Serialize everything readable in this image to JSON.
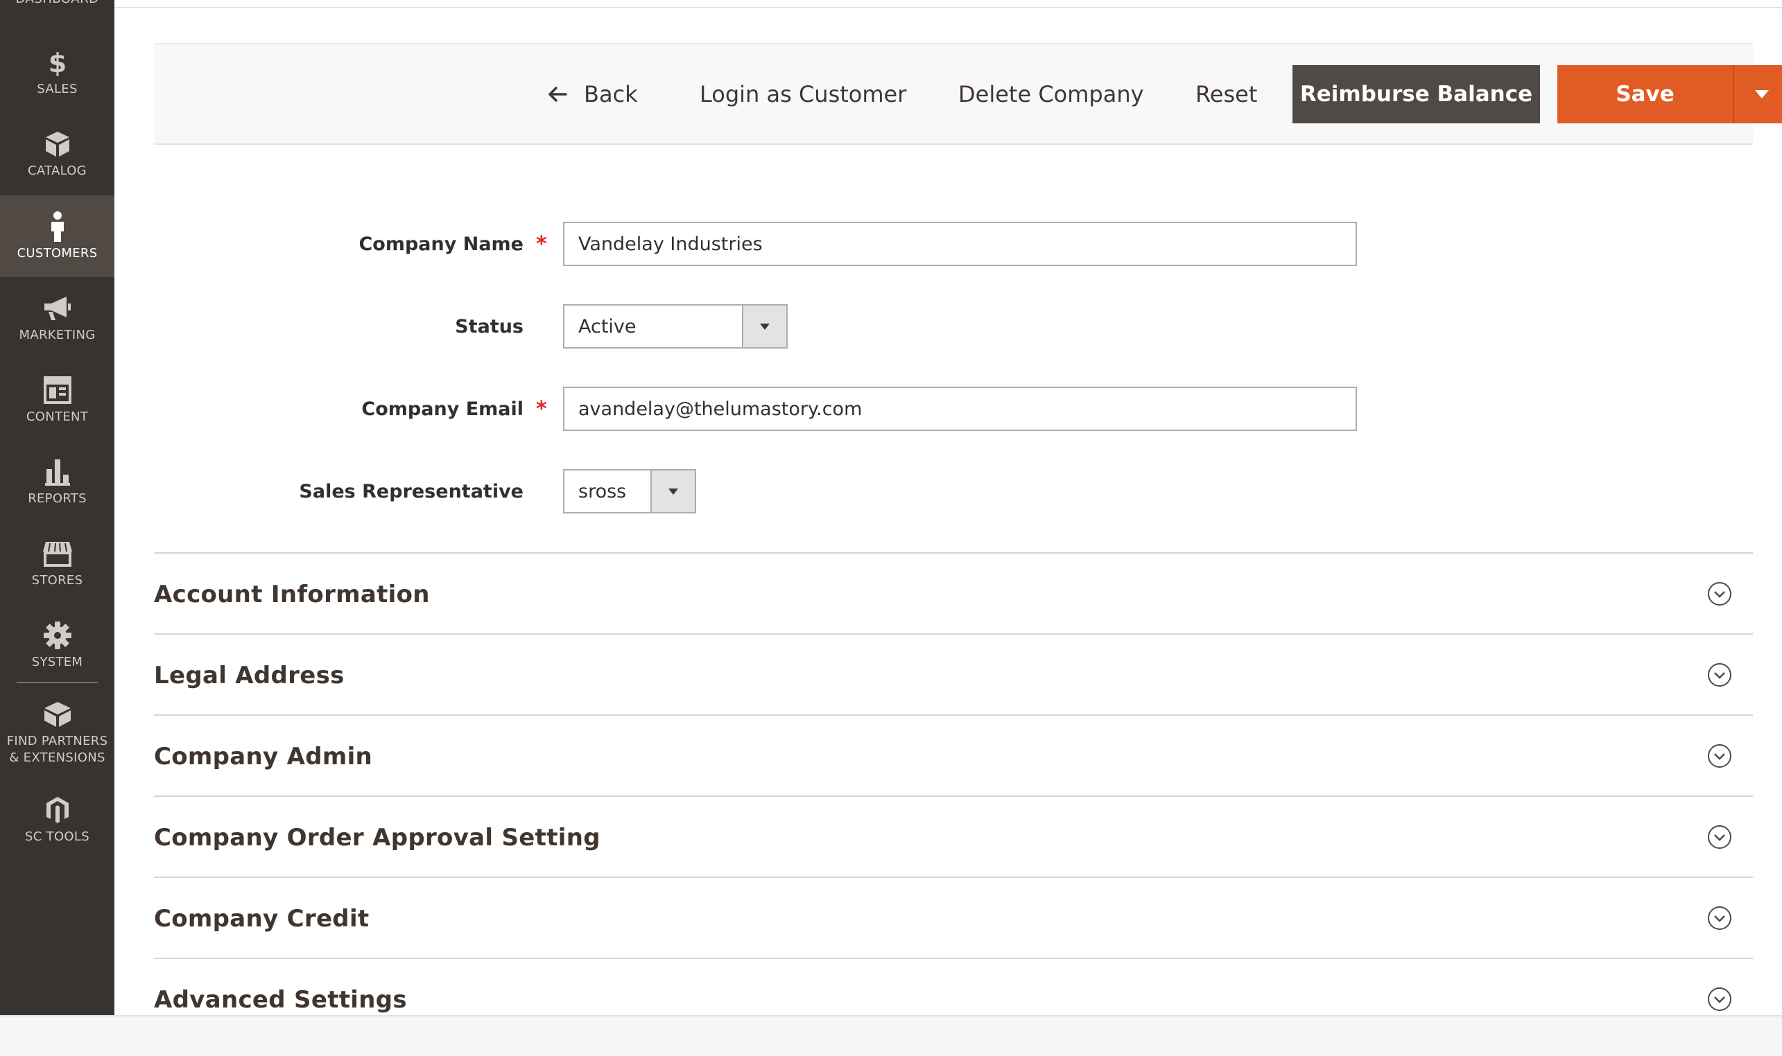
{
  "sidebar": {
    "partial_top_label": "DASHBOARD",
    "items": [
      {
        "label": "SALES",
        "icon": "dollar-icon"
      },
      {
        "label": "CATALOG",
        "icon": "box-icon"
      },
      {
        "label": "CUSTOMERS",
        "icon": "person-icon",
        "active": true
      },
      {
        "label": "MARKETING",
        "icon": "megaphone-icon"
      },
      {
        "label": "CONTENT",
        "icon": "layout-icon"
      },
      {
        "label": "REPORTS",
        "icon": "bar-chart-icon"
      },
      {
        "label": "STORES",
        "icon": "storefront-icon"
      },
      {
        "label": "SYSTEM",
        "icon": "gear-icon"
      },
      {
        "label": "FIND PARTNERS & EXTENSIONS",
        "icon": "cube-icon"
      },
      {
        "label": "SC TOOLS",
        "icon": "magento-logo-icon"
      }
    ]
  },
  "actions": {
    "back": "Back",
    "login_as_customer": "Login as Customer",
    "delete_company": "Delete Company",
    "reset": "Reset",
    "reimburse_balance": "Reimburse Balance",
    "save": "Save"
  },
  "form": {
    "company_name": {
      "label": "Company Name",
      "value": "Vandelay Industries",
      "required": true
    },
    "status": {
      "label": "Status",
      "value": "Active"
    },
    "company_email": {
      "label": "Company Email",
      "value": "avandelay@thelumastory.com",
      "required": true
    },
    "sales_representative": {
      "label": "Sales Representative",
      "value": "sross"
    }
  },
  "sections": [
    "Account Information",
    "Legal Address",
    "Company Admin",
    "Company Order Approval Setting",
    "Company Credit",
    "Advanced Settings"
  ],
  "colors": {
    "sidebar_bg": "#373330",
    "sidebar_active": "#514943",
    "primary_button": "#e15b25",
    "secondary_button": "#514943",
    "required": "#e22626"
  }
}
